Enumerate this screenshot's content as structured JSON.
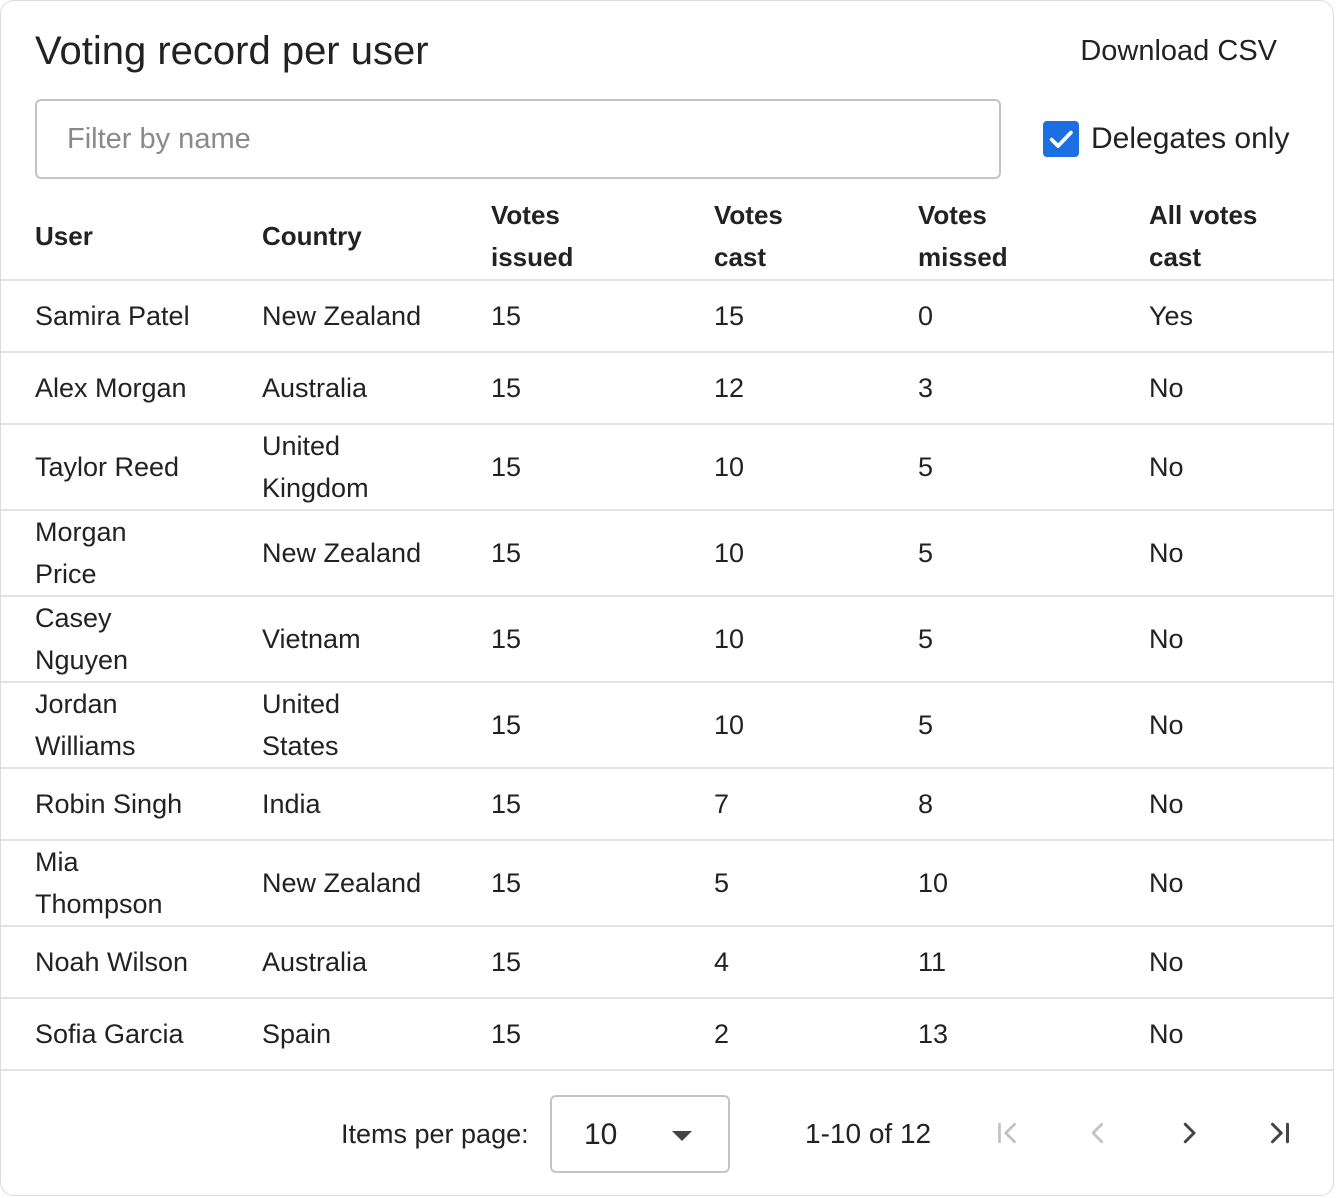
{
  "header": {
    "title": "Voting record per user",
    "download_label": "Download CSV"
  },
  "filter": {
    "placeholder": "Filter by name",
    "value": ""
  },
  "delegates_checkbox": {
    "label": "Delegates only",
    "checked": true,
    "color": "#1b6fe0"
  },
  "table": {
    "columns": [
      "User",
      "Country",
      "Votes issued",
      "Votes cast",
      "Votes missed",
      "All votes cast"
    ],
    "rows": [
      [
        "Samira Patel",
        "New Zealand",
        "15",
        "15",
        "0",
        "Yes"
      ],
      [
        "Alex Morgan",
        "Australia",
        "15",
        "12",
        "3",
        "No"
      ],
      [
        "Taylor Reed",
        "United Kingdom",
        "15",
        "10",
        "5",
        "No"
      ],
      [
        "Morgan Price",
        "New Zealand",
        "15",
        "10",
        "5",
        "No"
      ],
      [
        "Casey Nguyen",
        "Vietnam",
        "15",
        "10",
        "5",
        "No"
      ],
      [
        "Jordan Williams",
        "United States",
        "15",
        "10",
        "5",
        "No"
      ],
      [
        "Robin Singh",
        "India",
        "15",
        "7",
        "8",
        "No"
      ],
      [
        "Mia Thompson",
        "New Zealand",
        "15",
        "5",
        "10",
        "No"
      ],
      [
        "Noah Wilson",
        "Australia",
        "15",
        "4",
        "11",
        "No"
      ],
      [
        "Sofia Garcia",
        "Spain",
        "15",
        "2",
        "13",
        "No"
      ]
    ]
  },
  "pagination": {
    "items_per_page_label": "Items per page:",
    "items_per_page_value": "10",
    "range_label": "1-10 of 12",
    "first_enabled": false,
    "prev_enabled": false,
    "next_enabled": true,
    "last_enabled": true,
    "icons": [
      "first-page-icon",
      "chevron-left-icon",
      "chevron-right-icon",
      "last-page-icon"
    ]
  }
}
